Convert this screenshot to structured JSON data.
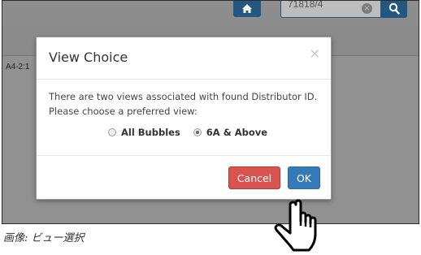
{
  "header": {
    "search_value": "71818/4",
    "clear_symbol": "×",
    "home_icon": "home-icon",
    "search_icon": "search-icon"
  },
  "background": {
    "row_label": "A4-2:1"
  },
  "modal": {
    "title": "View Choice",
    "close_symbol": "×",
    "message_line1": "There are two views associated with found Distributor ID.",
    "message_line2": "Please choose a preferred view:",
    "options": [
      {
        "label": "All Bubbles",
        "selected": false
      },
      {
        "label": "6A & Above",
        "selected": true
      }
    ],
    "cancel_label": "Cancel",
    "ok_label": "OK"
  },
  "colors": {
    "primary": "#337ab7",
    "danger": "#d9534f",
    "header_blue": "#24577f"
  },
  "caption": "画像: ビュー選択"
}
